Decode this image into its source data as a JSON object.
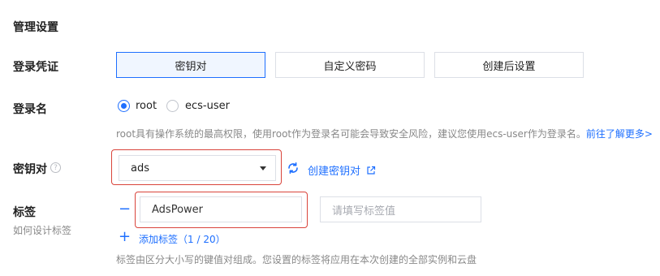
{
  "section": {
    "title": "管理设置"
  },
  "login_credential": {
    "label": "登录凭证",
    "options": [
      "密钥对",
      "自定义密码",
      "创建后设置"
    ],
    "selected": "密钥对"
  },
  "login_name": {
    "label": "登录名",
    "options": [
      "root",
      "ecs-user"
    ],
    "selected": "root",
    "hint": "root具有操作系统的最高权限，使用root作为登录名可能会导致安全风险，建议您使用ecs-user作为登录名。",
    "hint_link": "前往了解更多>"
  },
  "key_pair": {
    "label": "密钥对",
    "help_icon": "question-circle-icon",
    "help_glyph": "?",
    "selected_value": "ads",
    "refresh_icon": "refresh-icon",
    "create_link": "创建密钥对",
    "external_link_icon": "external-link-icon"
  },
  "tags": {
    "label": "标签",
    "sublabel": "如何设计标签",
    "rows": [
      {
        "key_value": "AdsPower",
        "value_placeholder": "请填写标签值"
      }
    ],
    "remove_icon": "minus-icon",
    "remove_glyph": "−",
    "add_icon": "plus-icon",
    "add_glyph": "+",
    "add_label": "添加标签",
    "count": "（1 / 20）",
    "hint": "标签由区分大小写的键值对组成。您设置的标签将应用在本次创建的全部实例和云盘"
  },
  "colors": {
    "primary": "#1e6fff",
    "highlight_outline": "#d9443b",
    "border": "#dcdfe6",
    "hint_text": "#888888"
  }
}
